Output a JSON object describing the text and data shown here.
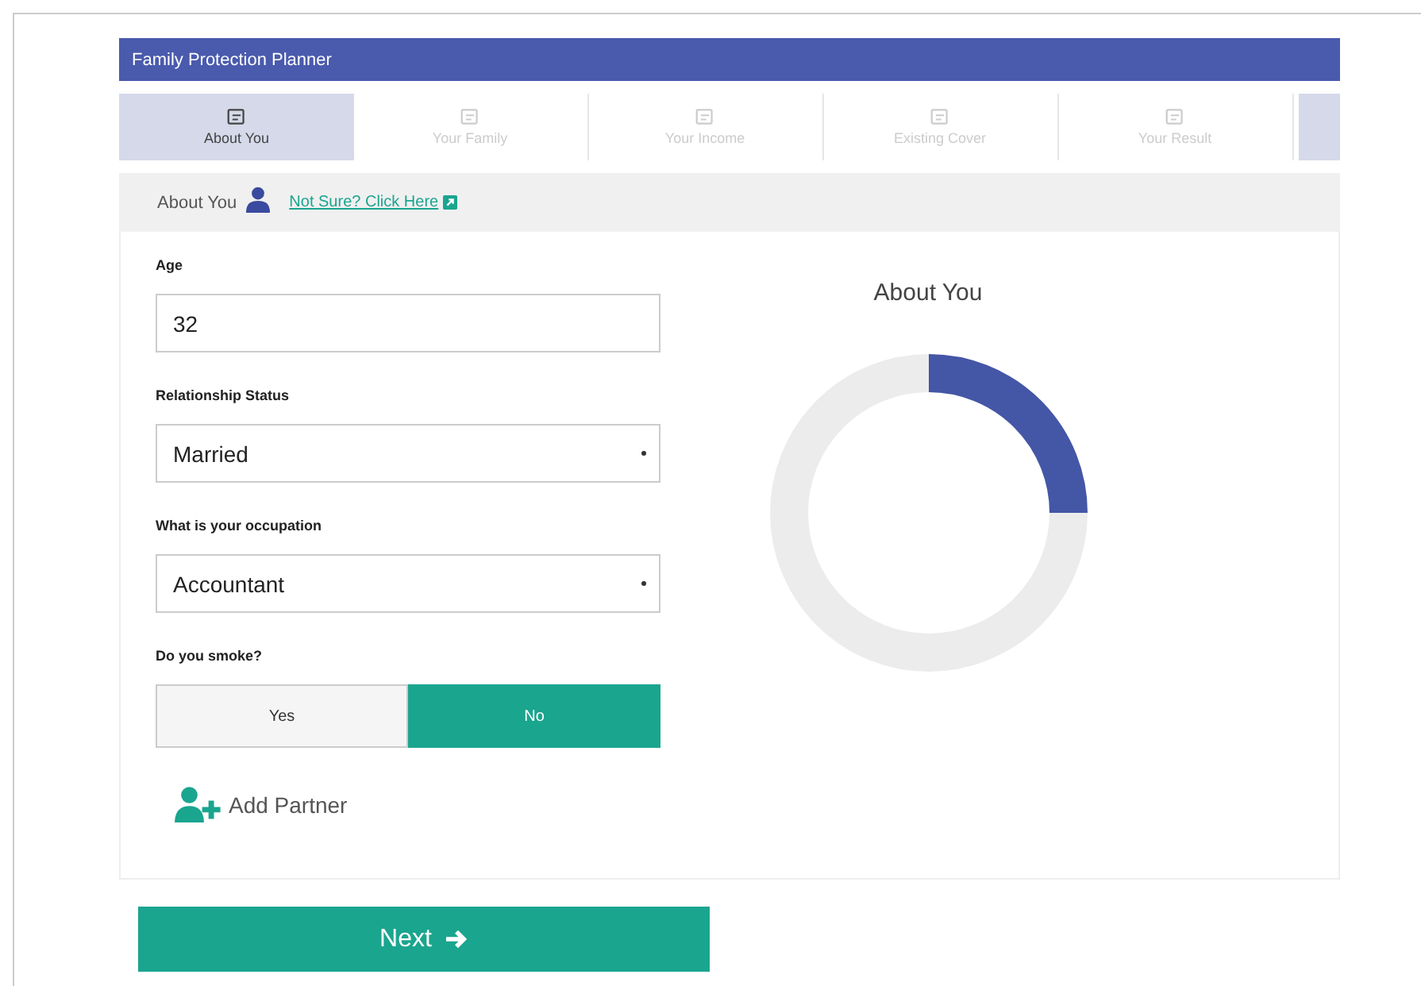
{
  "header": {
    "title": "Family Protection Planner"
  },
  "tabs": [
    {
      "label": "About You",
      "selected": true
    },
    {
      "label": "Your Family",
      "selected": false
    },
    {
      "label": "Your Income",
      "selected": false
    },
    {
      "label": "Existing Cover",
      "selected": false
    },
    {
      "label": "Your Result",
      "selected": false
    }
  ],
  "section": {
    "title": "About You",
    "link": "Not Sure? Click Here"
  },
  "fields": [
    {
      "kind": "text",
      "label": "Age",
      "value": "32"
    },
    {
      "kind": "select",
      "label": "Relationship Status",
      "value": "Married"
    },
    {
      "kind": "select",
      "label": "What is your occupation",
      "value": "Accountant"
    }
  ],
  "smoke": {
    "label": "Do you smoke?",
    "options": [
      {
        "label": "Yes",
        "selected": false
      },
      {
        "label": "No",
        "selected": true
      }
    ]
  },
  "add_partner": "Add Partner",
  "progress": {
    "title": "About You"
  },
  "next_button": "Next"
}
